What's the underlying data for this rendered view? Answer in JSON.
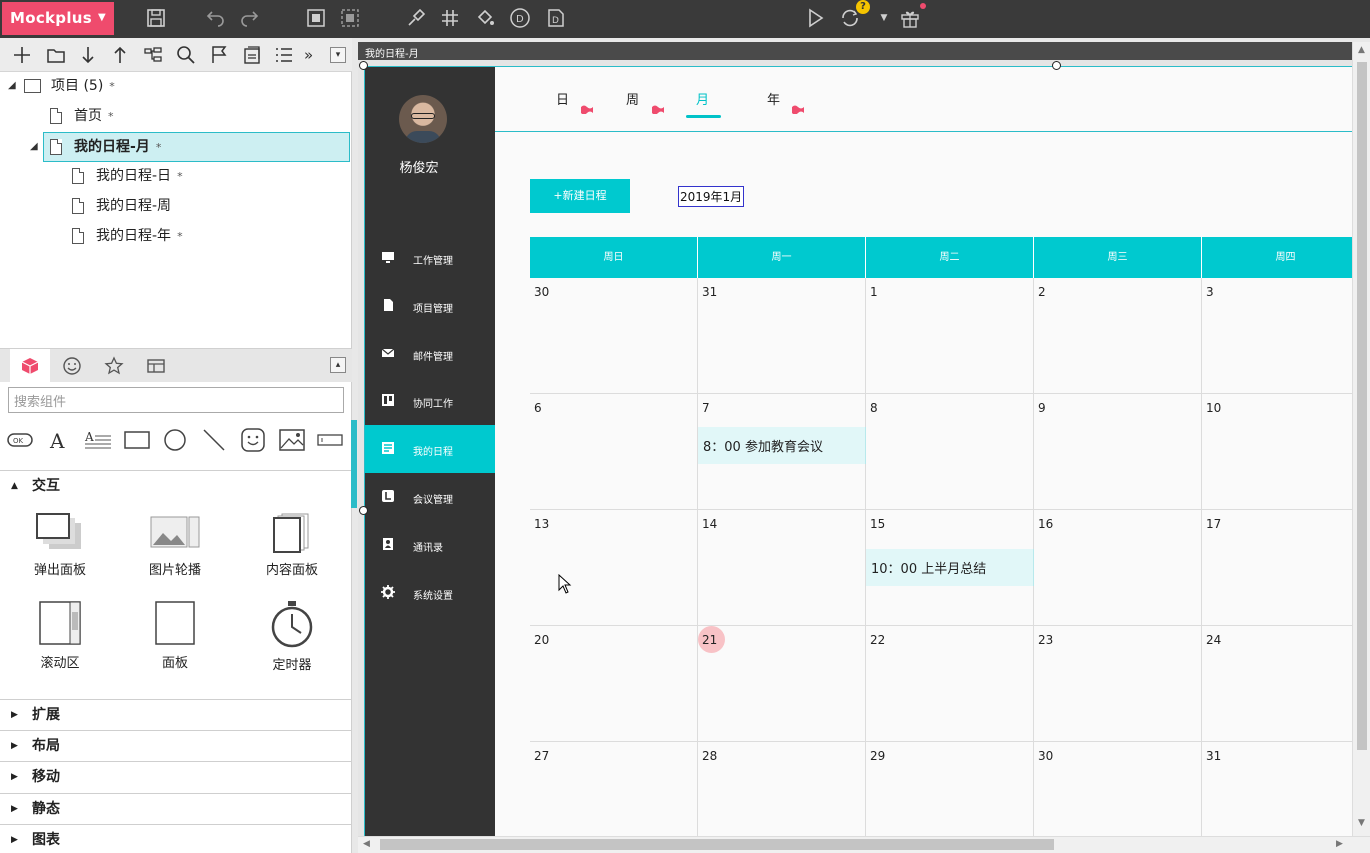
{
  "app": {
    "brand": "Mockplus"
  },
  "toolbar": {
    "icons": [
      "save-icon",
      "undo-icon",
      "redo-icon",
      "group-icon",
      "ungroup-icon",
      "format-brush-icon",
      "grid-icon",
      "fill-icon",
      "d-circle-icon",
      "doc-d-icon",
      "play-icon",
      "sync-icon",
      "gift-icon"
    ],
    "sync_badge": "?"
  },
  "project_tree": {
    "root": {
      "label": "项目 (5)",
      "mark": "*"
    },
    "items": [
      {
        "label": "首页",
        "mark": "*"
      },
      {
        "label": "我的日程-月",
        "mark": "*"
      },
      {
        "label": "我的日程-日",
        "mark": "*"
      },
      {
        "label": "我的日程-周",
        "mark": ""
      },
      {
        "label": "我的日程-年",
        "mark": "*"
      }
    ]
  },
  "components": {
    "search_placeholder": "搜索组件",
    "sections": [
      {
        "label": "交互",
        "expanded": true
      },
      {
        "label": "扩展"
      },
      {
        "label": "布局"
      },
      {
        "label": "移动"
      },
      {
        "label": "静态"
      },
      {
        "label": "图表"
      }
    ],
    "widgets": [
      "弹出面板",
      "图片轮播",
      "内容面板",
      "滚动区",
      "面板",
      "定时器"
    ]
  },
  "canvas": {
    "title": "我的日程-月",
    "user_name": "杨俊宏",
    "menu": [
      {
        "label": "工作管理",
        "icon": "monitor-icon"
      },
      {
        "label": "项目管理",
        "icon": "file-icon"
      },
      {
        "label": "邮件管理",
        "icon": "mail-icon"
      },
      {
        "label": "协同工作",
        "icon": "board-icon"
      },
      {
        "label": "我的日程",
        "icon": "note-icon",
        "active": true
      },
      {
        "label": "会议管理",
        "icon": "meeting-icon"
      },
      {
        "label": "通讯录",
        "icon": "contacts-icon"
      },
      {
        "label": "系统设置",
        "icon": "gear-icon"
      }
    ],
    "view_tabs": [
      "日",
      "周",
      "月",
      "年"
    ],
    "active_tab": "月",
    "new_button": "+新建日程",
    "current_month": "2019年1月",
    "weekdays": [
      "周日",
      "周一",
      "周二",
      "周三",
      "周四"
    ],
    "weeks": [
      [
        "30",
        "31",
        "1",
        "2",
        "3"
      ],
      [
        "6",
        "7",
        "8",
        "9",
        "10"
      ],
      [
        "13",
        "14",
        "15",
        "16",
        "17"
      ],
      [
        "20",
        "21",
        "22",
        "23",
        "24"
      ],
      [
        "27",
        "28",
        "29",
        "30",
        "31"
      ]
    ],
    "today": "21",
    "events": [
      {
        "text": "8：00 参加教育会议"
      },
      {
        "text": "10：00 上半月总结"
      }
    ],
    "accent": "#00c9cf"
  }
}
